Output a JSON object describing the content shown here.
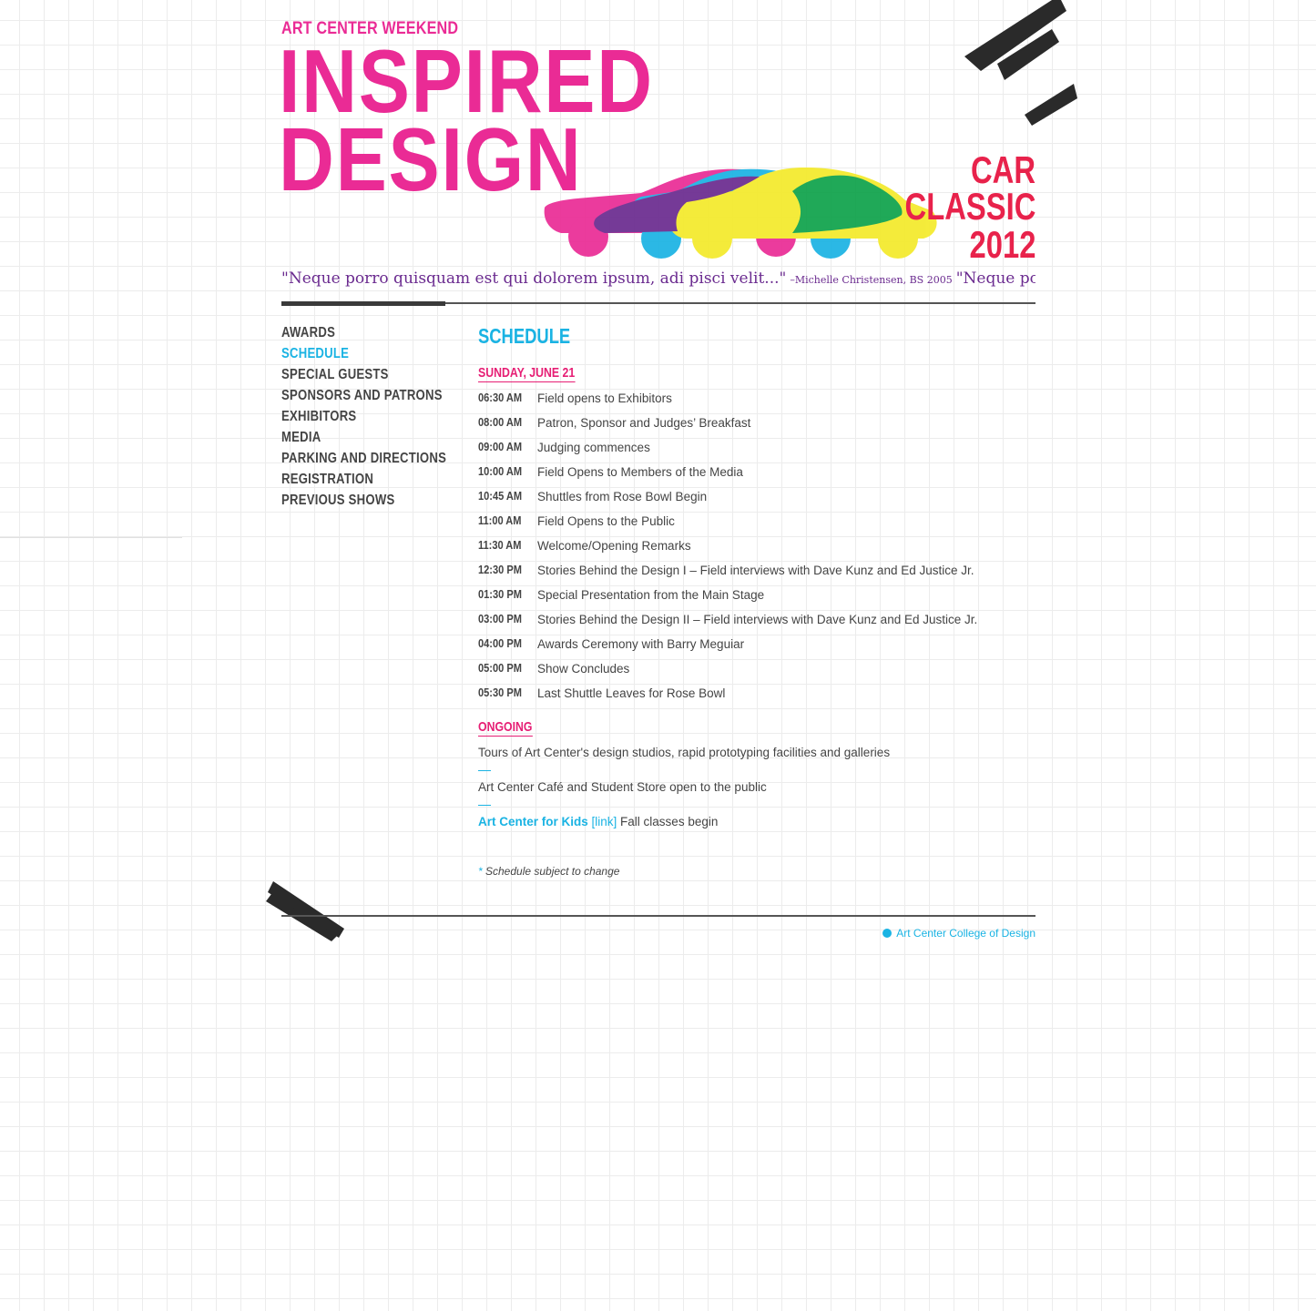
{
  "header": {
    "eyebrow": "ART CENTER WEEKEND",
    "title_line1": "INSPIRED",
    "title_line2": "DESIGN",
    "event_line1": "CAR",
    "event_line2": "CLASSIC",
    "event_line3": "2012"
  },
  "quote": {
    "text": "\"Neque porro quisquam est qui dolorem ipsum, adi pisci velit...\"",
    "attribution": "–Michelle Christensen, BS 2005",
    "repeat_text": "\"Neque porro qu"
  },
  "nav": {
    "items": [
      {
        "label": "AWARDS"
      },
      {
        "label": "SCHEDULE"
      },
      {
        "label": "SPECIAL GUESTS"
      },
      {
        "label": "SPONSORS AND PATRONS"
      },
      {
        "label": "EXHIBITORS"
      },
      {
        "label": "MEDIA"
      },
      {
        "label": "PARKING AND DIRECTIONS"
      },
      {
        "label": "REGISTRATION"
      },
      {
        "label": "PREVIOUS SHOWS"
      }
    ],
    "active": "SCHEDULE"
  },
  "schedule": {
    "heading": "SCHEDULE",
    "day": "SUNDAY, JUNE 21",
    "items": [
      {
        "time": "06:30 AM",
        "desc": "Field opens to Exhibitors"
      },
      {
        "time": "08:00 AM",
        "desc": "Patron, Sponsor and Judges’ Breakfast"
      },
      {
        "time": "09:00 AM",
        "desc": "Judging commences"
      },
      {
        "time": "10:00 AM",
        "desc": "Field Opens to Members of the Media"
      },
      {
        "time": "10:45 AM",
        "desc": "Shuttles from Rose Bowl Begin"
      },
      {
        "time": "11:00 AM",
        "desc": "Field Opens to the Public"
      },
      {
        "time": "11:30 AM",
        "desc": "Welcome/Opening Remarks"
      },
      {
        "time": "12:30 PM",
        "desc": "Stories Behind the Design I – Field interviews with Dave Kunz and Ed Justice Jr."
      },
      {
        "time": "01:30 PM",
        "desc": "Special Presentation from the Main Stage"
      },
      {
        "time": "03:00 PM",
        "desc": "Stories Behind the Design II – Field interviews with Dave Kunz and Ed Justice Jr."
      },
      {
        "time": "04:00 PM",
        "desc": "Awards Ceremony with Barry Meguiar"
      },
      {
        "time": "05:00 PM",
        "desc": "Show Concludes"
      },
      {
        "time": "05:30 PM",
        "desc": "Last Shuttle Leaves for Rose Bowl"
      }
    ]
  },
  "ongoing": {
    "heading": "ONGOING",
    "item1": "Tours of Art Center's design studios, rapid prototyping facilities and galleries",
    "item2": "Art Center Café and Student Store open to the public",
    "kids_link": "Art Center for Kids",
    "kids_link_tag": "[link]",
    "kids_text": " Fall classes begin"
  },
  "note": {
    "star": "*",
    "text": " Schedule subject to change"
  },
  "footer": {
    "link": "Art Center College of Design"
  },
  "colors": {
    "pink": "#ea2b95",
    "cyan": "#1ab3e3",
    "red": "#e8224b",
    "purple": "#6a2a8f",
    "yellow": "#f4ea2a",
    "green": "#0ea24a",
    "text": "#444444"
  }
}
